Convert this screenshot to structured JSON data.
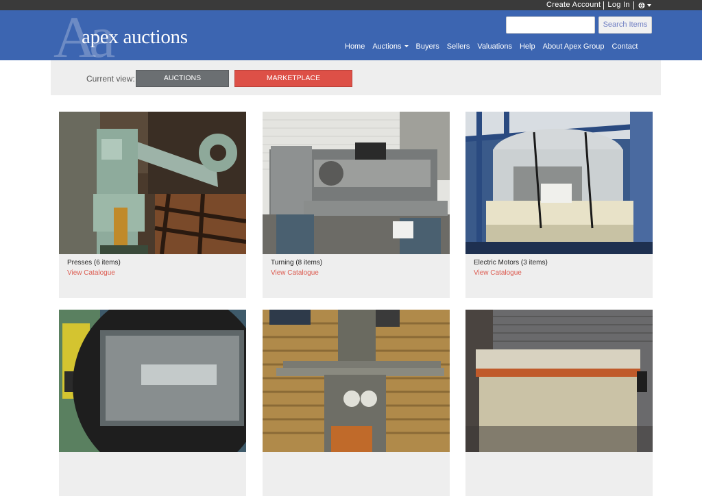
{
  "topbar": {
    "create_account": "Create Account",
    "log_in": "Log In"
  },
  "header": {
    "logo_mark": "Aa",
    "logo_text": "apex auctions",
    "search": {
      "value": "",
      "button": "Search Items"
    },
    "nav": [
      "Home",
      "Auctions",
      "Buyers",
      "Sellers",
      "Valuations",
      "Help",
      "About Apex Group",
      "Contact"
    ]
  },
  "view": {
    "label": "Current view:",
    "auctions": "AUCTIONS",
    "marketplace": "MARKETPLACE"
  },
  "cards": [
    {
      "title": "Presses (6 items)",
      "link": "View Catalogue"
    },
    {
      "title": "Turning (8 items)",
      "link": "View Catalogue"
    },
    {
      "title": "Electric Motors (3 items)",
      "link": "View Catalogue"
    },
    {
      "title": "",
      "link": ""
    },
    {
      "title": "",
      "link": ""
    },
    {
      "title": "",
      "link": ""
    }
  ],
  "colors": {
    "header_blue": "#3c65b1",
    "marketplace_red": "#dd5047",
    "auctions_gray": "#6b6f72",
    "link_red": "#dc5a4f"
  }
}
